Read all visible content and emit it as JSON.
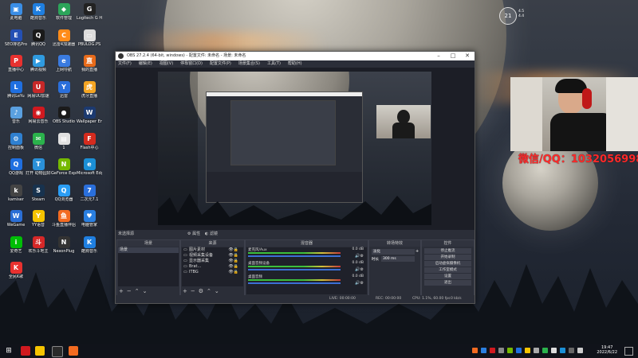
{
  "desktop_icons": [
    {
      "label": "此电脑",
      "color": "#3a8ee6",
      "glyph": "▣"
    },
    {
      "label": "酷狗音乐",
      "color": "#1f7fe0",
      "glyph": "K"
    },
    {
      "label": "软件管理",
      "color": "#2ca55a",
      "glyph": "◆"
    },
    {
      "label": "Logitech G HUB",
      "color": "#222",
      "glyph": "G"
    },
    {
      "label": "SEO排名Pro",
      "color": "#2450b4",
      "glyph": "E"
    },
    {
      "label": "腾讯QQ",
      "color": "#1a1a1a",
      "glyph": "Q"
    },
    {
      "label": "迅雷4加速器",
      "color": "#ff8c1a",
      "glyph": "C"
    },
    {
      "label": "PBULOG.PS",
      "color": "#dddddd",
      "glyph": "▭"
    },
    {
      "label": "直播中心",
      "color": "#e8312f",
      "glyph": "P"
    },
    {
      "label": "腾讯视频",
      "color": "#2f9be0",
      "glyph": "▶"
    },
    {
      "label": "上网导航",
      "color": "#3a7be0",
      "glyph": "e"
    },
    {
      "label": "我的直播",
      "color": "#e86b1a",
      "glyph": "直"
    },
    {
      "label": "腾讯LeYu",
      "color": "#1f6fe0",
      "glyph": "L"
    },
    {
      "label": "网易UU加速",
      "color": "#c62828",
      "glyph": "U"
    },
    {
      "label": "迅雷",
      "color": "#2a6fdb",
      "glyph": "Y"
    },
    {
      "label": "虎牙直播",
      "color": "#f5a623",
      "glyph": "虎"
    },
    {
      "label": "音乐",
      "color": "#5aa0e0",
      "glyph": "♪"
    },
    {
      "label": "网易云音乐",
      "color": "#d0191f",
      "glyph": "◉"
    },
    {
      "label": "OBS Studio",
      "color": "#1b1b1b",
      "glyph": "●"
    },
    {
      "label": "Wallpaper Engine",
      "color": "#1c3a70",
      "glyph": "W"
    },
    {
      "label": "控制面板",
      "color": "#2f80d0",
      "glyph": "⚙"
    },
    {
      "label": "微信",
      "color": "#2bb24c",
      "glyph": "✉"
    },
    {
      "label": "1",
      "color": "#e0e0e0",
      "glyph": "▤"
    },
    {
      "label": "Flash中心",
      "color": "#d52b1e",
      "glyph": "F"
    },
    {
      "label": "QQ游戏",
      "color": "#1f6fe0",
      "glyph": "Q"
    },
    {
      "label": "打开 动物园好友...",
      "color": "#2a90d8",
      "glyph": "T"
    },
    {
      "label": "GeForce Experience",
      "color": "#76b900",
      "glyph": "N"
    },
    {
      "label": "Microsoft Edge",
      "color": "#1b8fd6",
      "glyph": "e"
    },
    {
      "label": "kamiser",
      "color": "#444",
      "glyph": "k"
    },
    {
      "label": "Steam",
      "color": "#17324e",
      "glyph": "S"
    },
    {
      "label": "QQ浏览器",
      "color": "#2a9df4",
      "glyph": "Q"
    },
    {
      "label": "二次元7.1",
      "color": "#2a6fdb",
      "glyph": "7"
    },
    {
      "label": "WeGame",
      "color": "#2b6fd6",
      "glyph": "W"
    },
    {
      "label": "YY语音",
      "color": "#f5c400",
      "glyph": "Y"
    },
    {
      "label": "斗鱼直播伴侣",
      "color": "#f36b21",
      "glyph": "鱼"
    },
    {
      "label": "电脑管家",
      "color": "#2a7fe0",
      "glyph": "♥"
    },
    {
      "label": "爱奇艺",
      "color": "#00be06",
      "glyph": "i"
    },
    {
      "label": "欢乐斗地主",
      "color": "#d62828",
      "glyph": "斗"
    },
    {
      "label": "NexonPlug",
      "color": "#333",
      "glyph": "N"
    },
    {
      "label": "酷狗音乐",
      "color": "#1f7fe0",
      "glyph": "K"
    },
    {
      "label": "全民K歌",
      "color": "#e8312f",
      "glyph": "K"
    }
  ],
  "weather": {
    "temp": "21",
    "line1": "4.5",
    "line2": "4.4"
  },
  "obs": {
    "title": "OBS 27.2.4 (64-bit, windows) - 配置文件: 未命名 - 场景: 未命名",
    "menu": [
      "文件(F)",
      "编辑(E)",
      "视图(V)",
      "停靠窗口(D)",
      "配置文件(P)",
      "场景集合(S)",
      "工具(T)",
      "帮助(H)"
    ],
    "scene_bar_label": "未选择源",
    "scene_props": "属性",
    "scene_filters": "滤镜",
    "panels": {
      "scenes": "场景",
      "sources": "来源",
      "mixer": "混音器",
      "transitions": "转场特效",
      "controls": "控件"
    },
    "scene_items": [
      "场景"
    ],
    "source_items": [
      "图片素材",
      "视频采集设备",
      "显示器采集",
      "Brat... ",
      "ITBG"
    ],
    "mixer_items": [
      {
        "name": "麦克风/Aux",
        "db": "0.0 dB"
      },
      {
        "name": "桌面音频设备",
        "db": "0.0 dB"
      },
      {
        "name": "桌面音频",
        "db": "0.0 dB"
      }
    ],
    "transition": {
      "type": "淡化",
      "duration_label": "时长",
      "duration": "300 ms"
    },
    "controls": [
      "停止推流",
      "开始录制",
      "启动虚拟摄像机",
      "工作室模式",
      "设置",
      "退出"
    ],
    "status": {
      "live": "LIVE: 00:00:00",
      "rec": "REC: 00:00:00",
      "cpu": "CPU: 1.1%, 60.00 fps",
      "kb": "0 kb/s"
    }
  },
  "danmu": "微信/QQ：1032056998",
  "clock": {
    "time": "19:47",
    "date": "2022/6/22"
  },
  "colors": {
    "obs_bg": "#2b2e38",
    "accent_red": "#ff2a2a"
  }
}
